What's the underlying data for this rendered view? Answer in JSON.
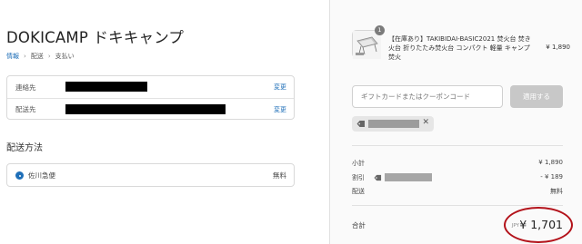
{
  "shop": {
    "title": "DOKICAMP ドキキャンプ"
  },
  "breadcrumb": {
    "info": "情報",
    "shipping": "配送",
    "payment": "支払い"
  },
  "info": {
    "contact_label": "連絡先",
    "ship_to_label": "配送先",
    "change_label": "変更"
  },
  "shipping_method": {
    "title": "配送方法",
    "option_name": "佐川急便",
    "option_price": "無料"
  },
  "order": {
    "product": {
      "quantity": "1",
      "name": "【在庫あり】TAKIBIDAI-BASIC2021 焚火台 焚き火台 折りたたみ焚火台 コンパクト 軽量 キャンプ 焚火",
      "price": "¥ 1,890"
    },
    "coupon": {
      "placeholder": "ギフトカードまたはクーポンコード",
      "apply_label": "適用する"
    },
    "summary": {
      "subtotal_label": "小計",
      "subtotal_value": "¥ 1,890",
      "discount_label": "割引",
      "discount_value": "- ¥ 189",
      "shipping_label": "配送",
      "shipping_value": "無料"
    },
    "total": {
      "label": "合計",
      "currency": "JPY",
      "value": "¥ 1,701"
    }
  },
  "colors": {
    "link": "#1f6fb8",
    "annotation_ring": "#b3121a",
    "button_disabled": "#c8c8c8"
  }
}
